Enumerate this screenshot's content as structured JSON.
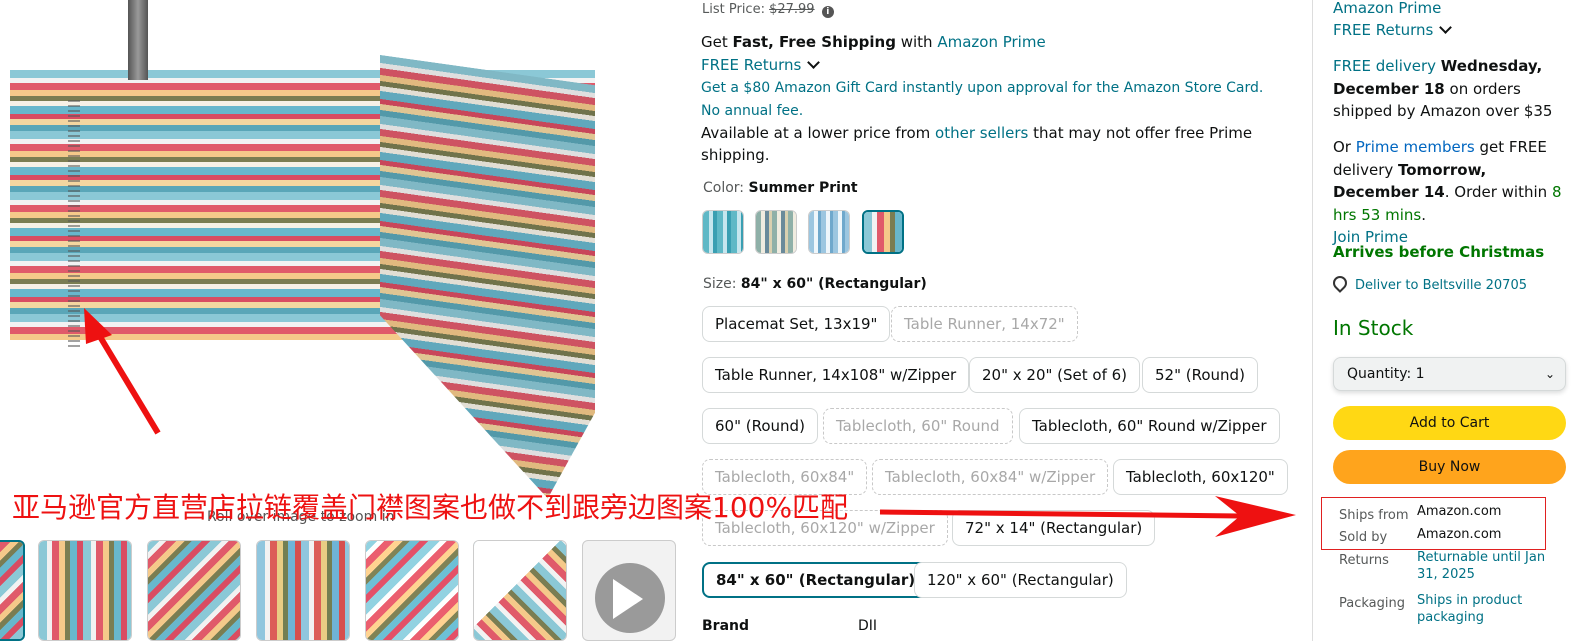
{
  "left": {
    "roll_over": "Roll over image to zoom in",
    "annotation": "亚马逊官方直营店拉链覆盖门襟图案也做不到跟旁边图案100%匹配",
    "annotation_color": "#ee1111",
    "video_icon": "play-icon"
  },
  "mid": {
    "list_price_label": "List Price:",
    "list_price": "$27.99",
    "shipping_prefix": "Get",
    "shipping_bold": "Fast, Free Shipping",
    "shipping_with": "with",
    "shipping_prime": "Amazon Prime",
    "free_returns": "FREE Returns",
    "gift_card": "Get a $80 Amazon Gift Card instantly upon approval for the Amazon Store Card. No annual fee.",
    "lower_price_pre": "Available at a lower price from",
    "lower_price_link": "other sellers",
    "lower_price_post": "that may not offer free Prime shipping.",
    "color_label": "Color:",
    "color_value": "Summer Print",
    "size_label": "Size:",
    "size_value": "84\" x 60\" (Rectangular)",
    "sizes": [
      "Placemat Set, 13x19\"",
      "Table Runner, 14x72\"",
      "Table Runner, 14x108\" w/Zipper",
      "20\" x 20\" (Set of 6)",
      "52\" (Round)",
      "60\" (Round)",
      "Tablecloth, 60\" Round",
      "Tablecloth, 60\" Round w/Zipper",
      "Tablecloth, 60x84\"",
      "Tablecloth, 60x84\" w/Zipper",
      "Tablecloth, 60x120\"",
      "Tablecloth, 60x120\" w/Zipper",
      "72\" x 14\" (Rectangular)",
      "84\" x 60\" (Rectangular)",
      "120\" x 60\" (Rectangular)"
    ],
    "brand_label": "Brand",
    "brand_value": "DII"
  },
  "buybox": {
    "prime": "Amazon Prime",
    "free_returns": "FREE Returns",
    "delivery_link": "FREE delivery",
    "delivery_date": "Wednesday, December 18",
    "delivery_rest": "on orders shipped by Amazon over $35",
    "or": "Or",
    "prime_members": "Prime members",
    "get_free": "get FREE delivery",
    "fast_date": "Tomorrow, December 14",
    "order_within": ". Order within",
    "countdown": "8 hrs 53 mins",
    "period": ".",
    "join_prime": "Join Prime",
    "christmas": "Arrives before Christmas",
    "deliver_to": "Deliver to Beltsville 20705",
    "stock": "In Stock",
    "qty_label": "Quantity:",
    "qty_value": "1",
    "add_to_cart": "Add to Cart",
    "buy_now": "Buy Now",
    "ships_from_label": "Ships from",
    "ships_from": "Amazon.com",
    "sold_by_label": "Sold by",
    "sold_by": "Amazon.com",
    "returns_label": "Returns",
    "returns": "Returnable until Jan 31, 2025",
    "packaging_label": "Packaging",
    "packaging": "Ships in product packaging"
  }
}
